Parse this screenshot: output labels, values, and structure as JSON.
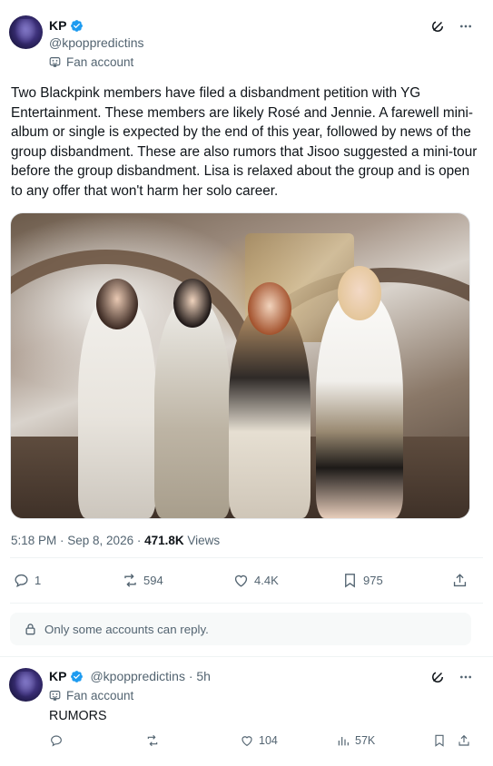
{
  "tweet": {
    "display_name": "KP",
    "handle": "@kpoppredictins",
    "fan_label": "Fan account",
    "text": "Two Blackpink members have filed a disbandment petition with YG Entertainment. These members are likely Rosé and Jennie. A farewell mini-album or single is expected by the end of this year, followed by news of the group disbandment. These are also rumors that Jisoo suggested a mini-tour before the group disbandment. Lisa is relaxed about the group and is open to any offer that won't harm her solo career.",
    "time": "5:18 PM · Sep 8, 2026 · ",
    "views_count": "471.8K",
    "views_label": " Views",
    "replies": "1",
    "reposts": "594",
    "likes": "4.4K",
    "bookmarks": "975",
    "reply_notice": "Only some accounts can reply."
  },
  "reply": {
    "display_name": "KP",
    "handle": "@kpoppredictins · 5h",
    "fan_label": "Fan account",
    "text": "RUMORS",
    "likes": "104",
    "views": "57K"
  },
  "colors": {
    "verified": "#1d9bf0",
    "secondary_text": "#536471",
    "primary_text": "#0f1419"
  },
  "icons": [
    "verified-badge-icon",
    "grok-icon",
    "more-icon",
    "fan-mask-icon",
    "reply-icon",
    "repost-icon",
    "like-icon",
    "bookmark-icon",
    "share-icon",
    "lock-icon",
    "views-icon"
  ]
}
